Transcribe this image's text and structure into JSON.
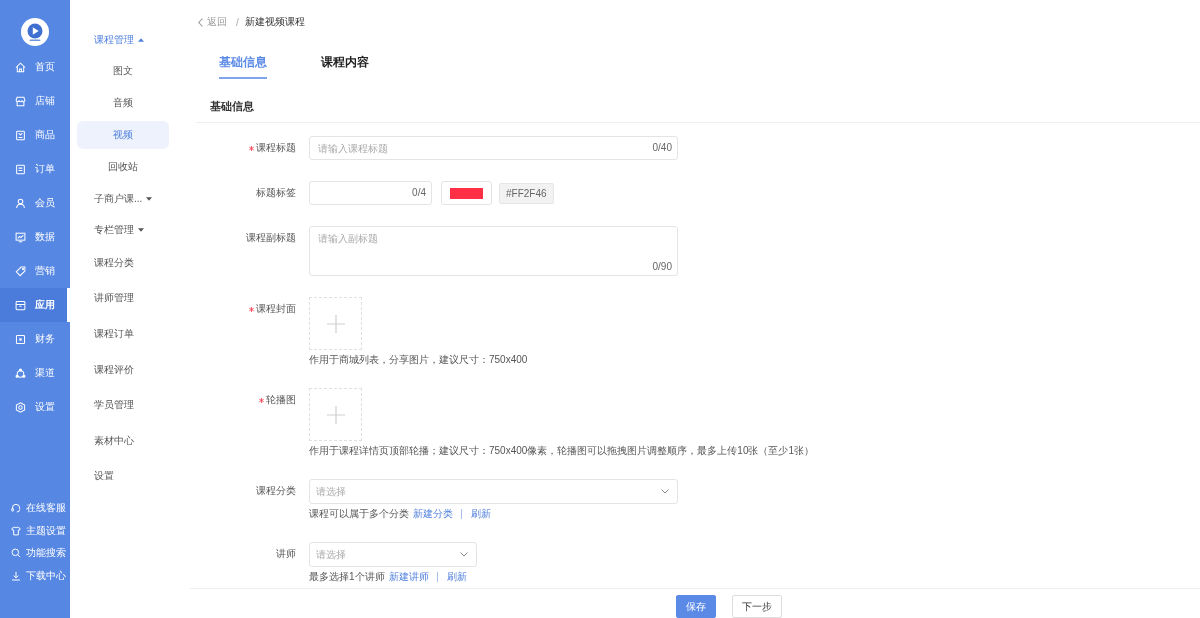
{
  "nav": {
    "items": [
      {
        "label": "首页",
        "selected": false
      },
      {
        "label": "店铺",
        "selected": false
      },
      {
        "label": "商品",
        "selected": false
      },
      {
        "label": "订单",
        "selected": false
      },
      {
        "label": "会员",
        "selected": false
      },
      {
        "label": "数据",
        "selected": false
      },
      {
        "label": "营销",
        "selected": false
      },
      {
        "label": "应用",
        "selected": true
      },
      {
        "label": "财务",
        "selected": false
      },
      {
        "label": "渠道",
        "selected": false
      },
      {
        "label": "设置",
        "selected": false
      }
    ],
    "tools": [
      {
        "label": "在线客服"
      },
      {
        "label": "主题设置"
      },
      {
        "label": "功能搜索"
      },
      {
        "label": "下载中心"
      }
    ]
  },
  "submenu": {
    "items": [
      {
        "kind": "group",
        "label": "课程管理",
        "expanded": true,
        "children": [
          {
            "label": "图文",
            "selected": false
          },
          {
            "label": "音频",
            "selected": false
          },
          {
            "label": "视频",
            "selected": true
          },
          {
            "label": "回收站",
            "selected": false
          }
        ]
      },
      {
        "kind": "group",
        "label": "子商户课...",
        "expanded": false
      },
      {
        "kind": "group",
        "label": "专栏管理",
        "expanded": false
      },
      {
        "kind": "link",
        "label": "课程分类",
        "selected": false
      },
      {
        "kind": "link",
        "label": "讲师管理",
        "selected": false
      },
      {
        "kind": "link",
        "label": "课程订单",
        "selected": false
      },
      {
        "kind": "link",
        "label": "课程评价",
        "selected": false
      },
      {
        "kind": "link",
        "label": "学员管理",
        "selected": false
      },
      {
        "kind": "link",
        "label": "素材中心",
        "selected": false
      },
      {
        "kind": "link",
        "label": "设置",
        "selected": false
      }
    ]
  },
  "breadcrumb": {
    "back": "返回",
    "separator": "/",
    "current": "新建视频课程"
  },
  "tabs": [
    {
      "label": "基础信息",
      "selected": true
    },
    {
      "label": "课程内容",
      "selected": false
    }
  ],
  "section": {
    "title": "基础信息"
  },
  "form": {
    "fields": [
      {
        "kind": "text",
        "label": "课程标题",
        "required": true,
        "placeholder": "请输入课程标题",
        "counter": "0/40"
      },
      {
        "kind": "tag",
        "label": "标题标签",
        "required": false,
        "counter": "0/4",
        "color_value": "#FF2F46"
      },
      {
        "kind": "textarea",
        "label": "课程副标题",
        "required": false,
        "placeholder": "请输入副标题",
        "counter": "0/90"
      },
      {
        "kind": "upload",
        "label": "课程封面",
        "required": true,
        "hint": "作用于商城列表，分享图片，建议尺寸：750x400"
      },
      {
        "kind": "upload",
        "label": "轮播图",
        "required": true,
        "hint": "作用于课程详情页顶部轮播；建议尺寸：750x400像素，轮播图可以拖拽图片调整顺序，最多上传10张（至少1张）"
      },
      {
        "kind": "select",
        "label": "课程分类",
        "required": false,
        "placeholder": "请选择",
        "hint": "课程可以属于多个分类",
        "links": [
          "新建分类",
          "刷新"
        ]
      },
      {
        "kind": "select",
        "label": "讲师",
        "required": false,
        "placeholder": "请选择",
        "hint": "最多选择1个讲师",
        "links": [
          "新建讲师",
          "刷新"
        ]
      }
    ]
  },
  "footer": {
    "buttons": [
      {
        "kind": "primary",
        "label": "保存"
      },
      {
        "kind": "default",
        "label": "下一步"
      }
    ]
  }
}
